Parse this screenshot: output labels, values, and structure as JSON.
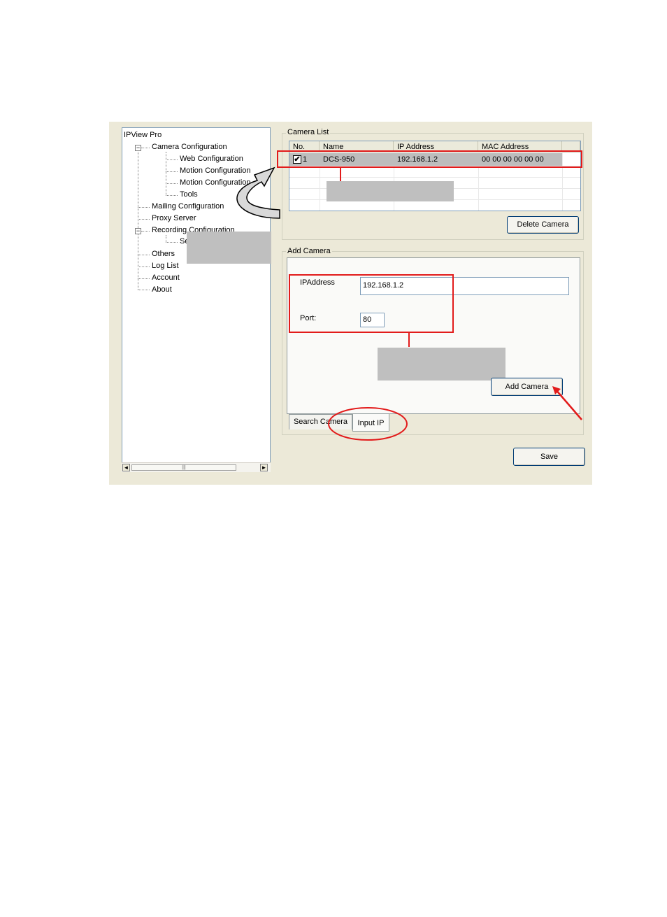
{
  "tree": {
    "root": "IPView Pro",
    "items": [
      {
        "label": "Camera Configuration",
        "level": 1
      },
      {
        "label": "Web Configuration",
        "level": 2
      },
      {
        "label": "Motion Configuration",
        "level": 2
      },
      {
        "label": "Motion Configuration",
        "level": 2
      },
      {
        "label": "Tools",
        "level": 2
      },
      {
        "label": "Mailing Configuration",
        "level": 1
      },
      {
        "label": "Proxy Server",
        "level": 1
      },
      {
        "label": "Recording Configuration",
        "level": 1
      },
      {
        "label": "Se",
        "level": 2
      },
      {
        "label": "Others",
        "level": 1
      },
      {
        "label": "Log List",
        "level": 1
      },
      {
        "label": "Account",
        "level": 1
      },
      {
        "label": "About",
        "level": 1
      }
    ],
    "scroll_left": "◄",
    "scroll_right": "►",
    "scroll_thumb": "|||"
  },
  "camera_list": {
    "legend": "Camera List",
    "columns": [
      "No.",
      "Name",
      "IP Address",
      "MAC Address"
    ],
    "rows": [
      {
        "no": "1",
        "name": "DCS-950",
        "ip": "192.168.1.2",
        "mac": "00 00 00 00 00 00",
        "checked": true
      }
    ],
    "checkmark": "✔",
    "delete_button": "Delete Camera"
  },
  "add_camera": {
    "legend": "Add Camera",
    "ip_label": "IPAddress",
    "ip_value": "192.168.1.2",
    "port_label": "Port:",
    "port_value": "80",
    "add_button": "Add Camera",
    "tabs": [
      "Search Camera",
      "Input IP"
    ]
  },
  "save_button": "Save",
  "colors": {
    "annotation_red": "#e21b1b",
    "window_bg": "#ece9d8",
    "selected_row": "#bdbdbd",
    "callout_gray": "#bfbfbf"
  }
}
